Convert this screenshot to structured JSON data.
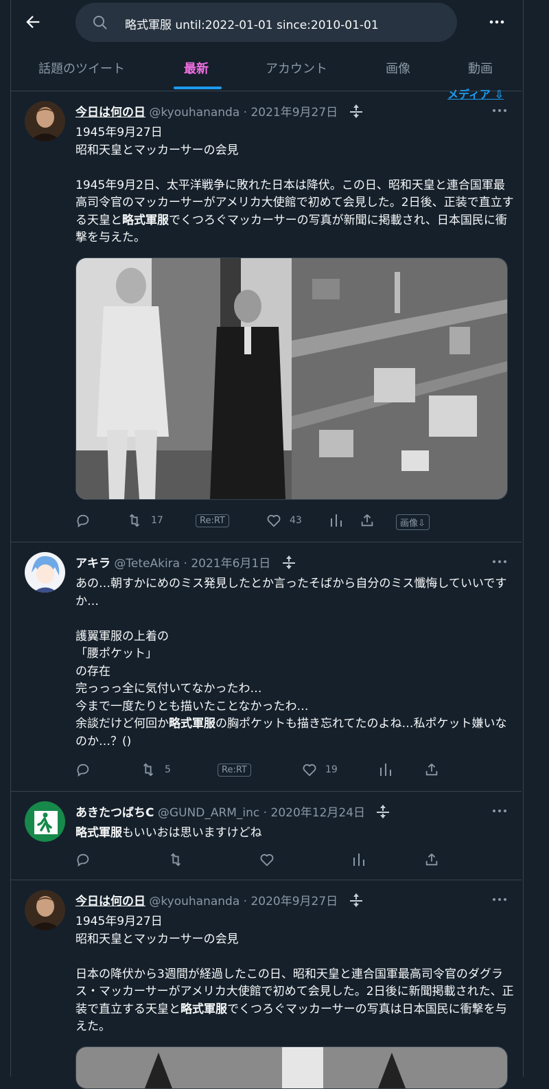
{
  "search": {
    "query": "略式軍服 until:2022-01-01 since:2010-01-01"
  },
  "tabs": [
    {
      "label": "話題のツイート"
    },
    {
      "label": "最新"
    },
    {
      "label": "アカウント"
    },
    {
      "label": "画像"
    },
    {
      "label": "動画"
    }
  ],
  "media_link": "メディア ⇩",
  "tweets": [
    {
      "name": "今日は何の日",
      "handle": "@kyouhananda",
      "date": "2021年9月27日",
      "body_pre": "1945年9月27日\n昭和天皇とマッカーサーの会見\n\n1945年9月2日、太平洋戦争に敗れた日本は降伏。この日、昭和天皇と連合国軍最高司令官のマッカーサーがアメリカ大使館で初めて会見した。2日後、正装で直立する天皇と",
      "body_bold": "略式軍服",
      "body_post": "でくつろぐマッカーサーの写真が新聞に掲載され、日本国民に衝撃を与えた。",
      "retweets": "17",
      "likes": "43",
      "rert_label": "Re:RT",
      "image_dl_label": "画像⇩"
    },
    {
      "name": "アキラ",
      "handle": "@TeteAkira",
      "date": "2021年6月1日",
      "body_pre": "あの…朝すかにめのミス発見したとか言ったそばから自分のミス懺悔していいですか…\n\n護翼軍服の上着の\n「腰ポケット」\nの存在\n完っっっ全に気付いてなかったわ…\n今まで一度たりとも描いたことなかったわ…\n余談だけど何回か",
      "body_bold": "略式軍服",
      "body_post": "の胸ポケットも描き忘れてたのよね…私ポケット嫌いなのか…？()",
      "retweets": "5",
      "likes": "19",
      "rert_label": "Re:RT"
    },
    {
      "name": "あきたつばちC",
      "handle": "@GUND_ARM_inc",
      "date": "2020年12月24日",
      "body_pre": "",
      "body_bold": "略式軍服",
      "body_post": "もいいおは思いますけどね"
    },
    {
      "name": "今日は何の日",
      "handle": "@kyouhananda",
      "date": "2020年9月27日",
      "body_pre": "1945年9月27日\n昭和天皇とマッカーサーの会見\n\n日本の降伏から3週間が経過したこの日、昭和天皇と連合国軍最高司令官のダグラス・マッカーサーがアメリカ大使館で初めて会見した。2日後に新聞掲載された、正装で直立する天皇と",
      "body_bold": "略式軍服",
      "body_post": "でくつろぐマッカーサーの写真は日本国民に衝撃を与えた。"
    }
  ]
}
